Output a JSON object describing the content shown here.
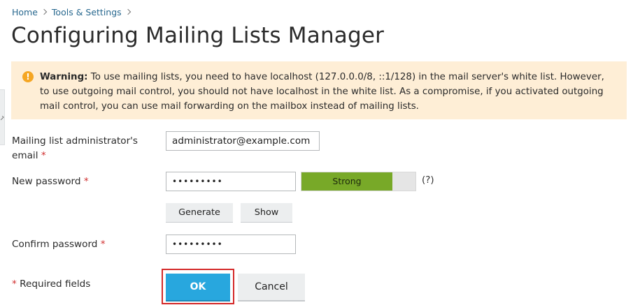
{
  "breadcrumb": {
    "items": [
      {
        "label": "Home"
      },
      {
        "label": "Tools & Settings"
      }
    ]
  },
  "page_title": "Configuring Mailing Lists Manager",
  "warning": {
    "icon": "exclamation-icon",
    "prefix": "Warning:",
    "text": "To use mailing lists, you need to have localhost (127.0.0.0/8, ::1/128) in the mail server's white list. However, to use outgoing mail control, you should not have localhost in the white list. As a compromise, if you activated outgoing mail control, you can use mail forwarding on the mailbox instead of mailing lists.",
    "background": "#feeed6",
    "icon_color": "#f5a623"
  },
  "form": {
    "admin_email": {
      "label": "Mailing list administrator's email",
      "required_mark": "*",
      "value": "administrator@example.com"
    },
    "new_password": {
      "label": "New password",
      "required_mark": "*",
      "value": "•••••••••",
      "strength_label": "Strong",
      "strength_fraction": 0.8,
      "strength_color": "#78a928",
      "help": "(?)"
    },
    "generate_label": "Generate",
    "show_label": "Show",
    "confirm_password": {
      "label": "Confirm password",
      "required_mark": "*",
      "value": "•••••••••"
    },
    "required_note": {
      "mark": "*",
      "text": "Required fields"
    }
  },
  "buttons": {
    "ok_label": "OK",
    "cancel_label": "Cancel",
    "ok_color": "#28a7de",
    "highlight_color": "#d42a2a"
  }
}
